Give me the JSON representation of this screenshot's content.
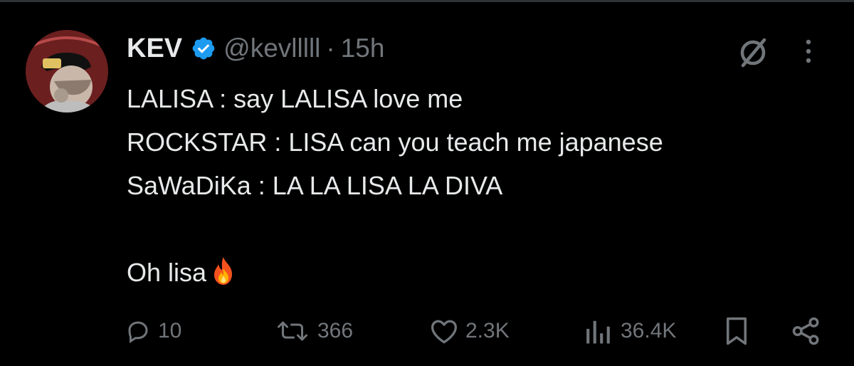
{
  "tweet": {
    "author": {
      "name": "KEV",
      "handle": "@kevlllll",
      "verified": true,
      "verified_color": "#1d9bf0"
    },
    "separator": "·",
    "time": "15h",
    "lines": [
      "LALISA : say LALISA love me",
      "ROCKSTAR : LISA can you teach me japanese",
      "SaWaDiKa : LA LA LISA LA DIVA",
      "",
      "Oh lisa"
    ],
    "trailing_emoji": "fire-emoji",
    "actions": {
      "replies": "10",
      "reposts": "366",
      "likes": "2.3K",
      "views": "36.4K"
    },
    "icons": [
      "grok-icon",
      "more-icon",
      "reply-icon",
      "repost-icon",
      "like-icon",
      "views-icon",
      "bookmark-icon",
      "share-icon"
    ]
  },
  "colors": {
    "background": "#000000",
    "text_primary": "#e7e9ea",
    "text_secondary": "#71767b",
    "accent": "#1d9bf0"
  }
}
